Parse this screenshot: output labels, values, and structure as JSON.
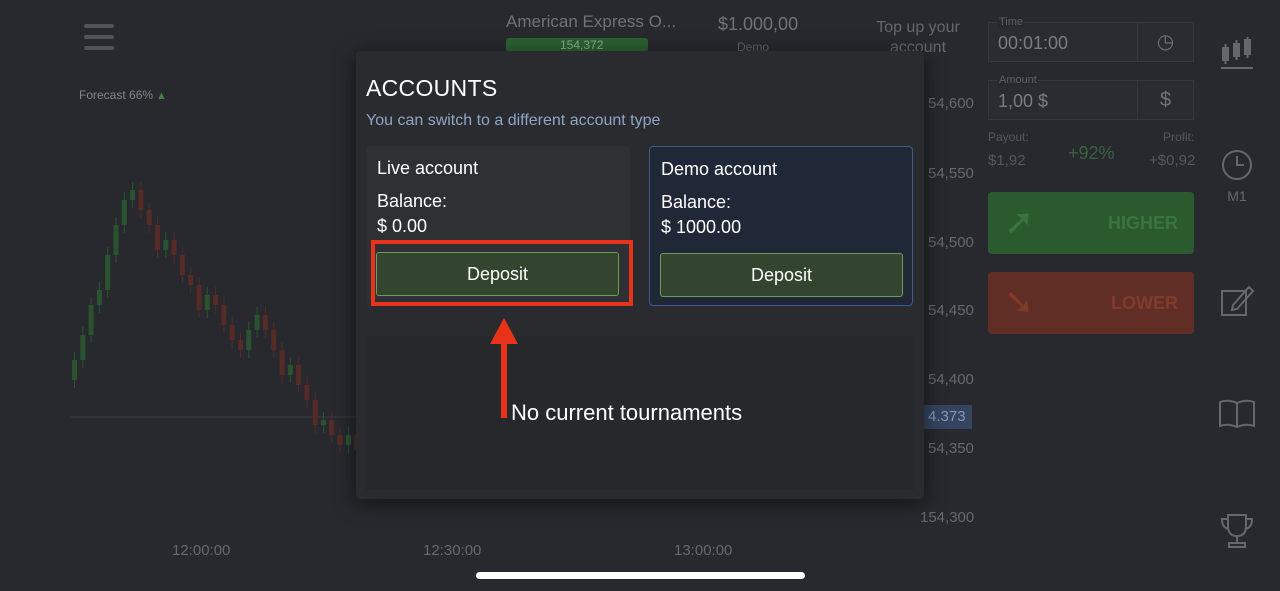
{
  "background": {
    "forecast": "Forecast 66%",
    "asset_name": "American Express O...",
    "asset_price": "154,372",
    "balance": "$1.000,00",
    "balance_mode": "Demo",
    "top_up": "Top up your account",
    "price_axis": [
      "54,600",
      "54,550",
      "54,500",
      "54,450",
      "54,400",
      "4.373",
      "54,350",
      "154,300"
    ],
    "time_axis": [
      "12:00:00",
      "12:30:00",
      "13:00:00"
    ],
    "trade_panel": {
      "time_label": "Time",
      "time_value": "00:01:00",
      "amount_label": "Amount",
      "amount_value": "1,00 $",
      "currency_symbol": "$",
      "payout_label": "Payout:",
      "payout_value": "$1,92",
      "payout_pct": "+92%",
      "profit_label": "Profit:",
      "profit_value": "+$0,92",
      "higher_label": "HIGHER",
      "lower_label": "LOWER"
    },
    "sidebar": {
      "timeframe": "M1"
    }
  },
  "modal": {
    "title": "ACCOUNTS",
    "subtitle": "You can switch to a different account type",
    "accounts": [
      {
        "name": "Live account",
        "balance_label": "Balance:",
        "balance": "$ 0.00",
        "button": "Deposit"
      },
      {
        "name": "Demo account",
        "balance_label": "Balance:",
        "balance": "$ 1000.00",
        "button": "Deposit"
      }
    ],
    "tournaments_text": "No current tournaments"
  },
  "colors": {
    "highlight": "#e8331a",
    "demo_border": "#3e5b8a",
    "deposit_border": "#6c9a5a"
  }
}
